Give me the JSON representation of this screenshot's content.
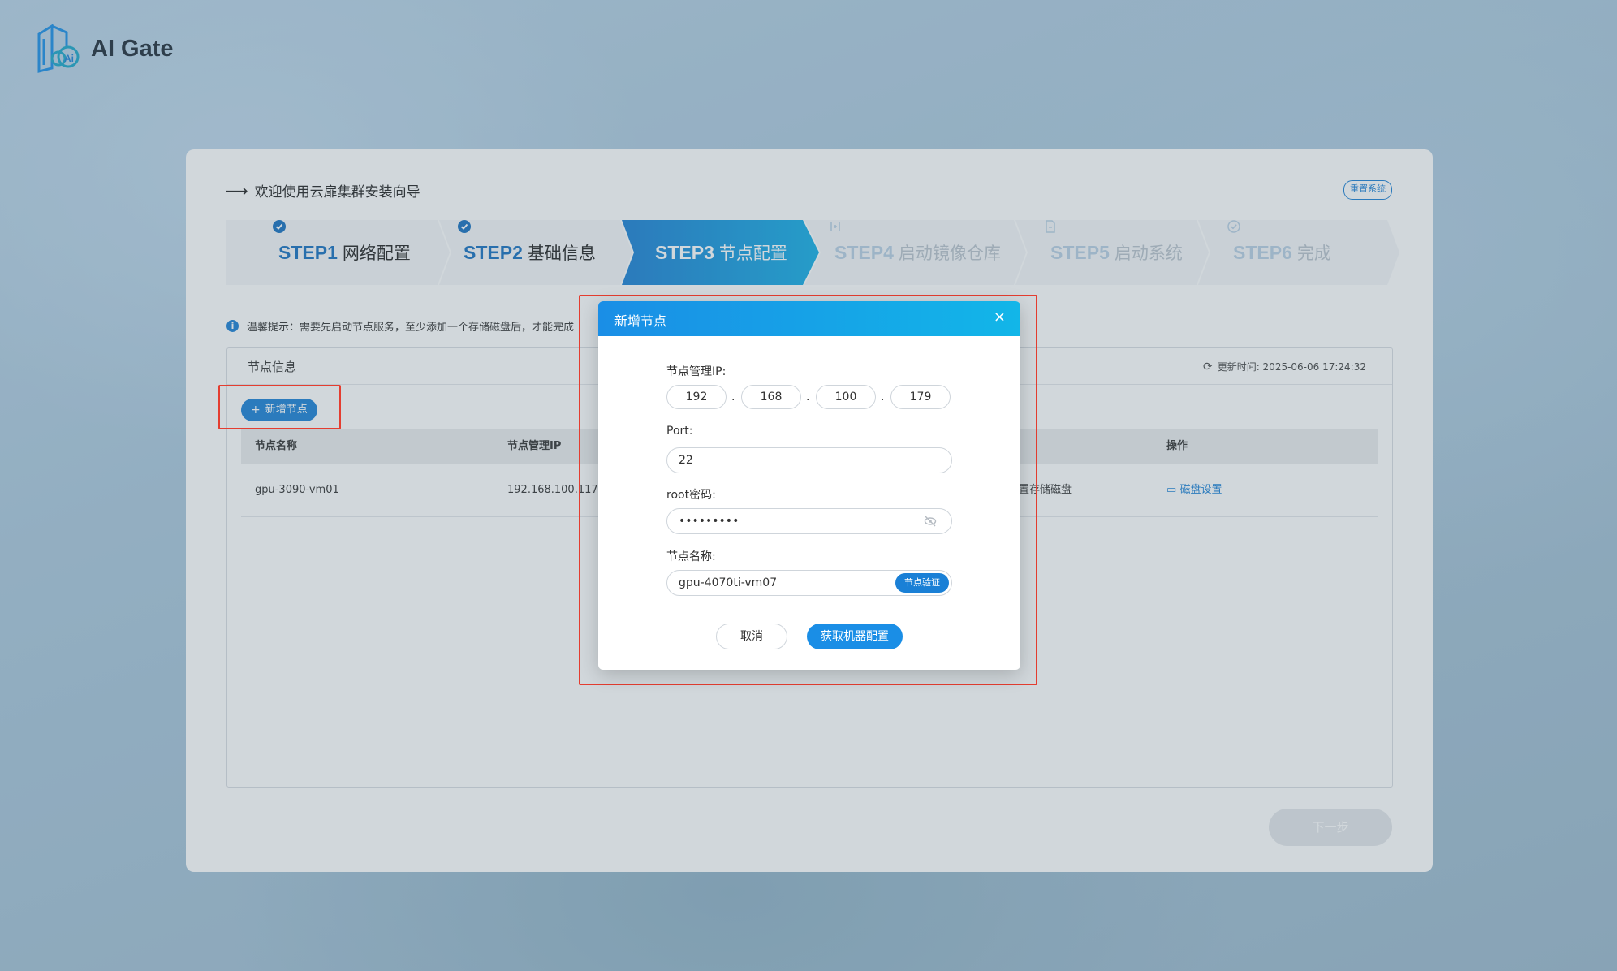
{
  "app": {
    "logo_text": "AI Gate"
  },
  "wizard": {
    "title": "欢迎使用云扉集群安装向导",
    "reset_label": "重置系统",
    "steps": [
      {
        "num": "STEP1",
        "name": "网络配置",
        "state": "done"
      },
      {
        "num": "STEP2",
        "name": "基础信息",
        "state": "done"
      },
      {
        "num": "STEP3",
        "name": "节点配置",
        "state": "active"
      },
      {
        "num": "STEP4",
        "name": "启动镜像仓库",
        "state": "todo"
      },
      {
        "num": "STEP5",
        "name": "启动系统",
        "state": "todo"
      },
      {
        "num": "STEP6",
        "name": "完成",
        "state": "todo"
      }
    ],
    "tip": "温馨提示：需要先启动节点服务，至少添加一个存储磁盘后，才能完成",
    "node_section": {
      "title": "节点信息",
      "update_time": "更新时间: 2025-06-06 17:24:32",
      "add_button": "新增节点"
    },
    "table": {
      "headers": [
        "节点名称",
        "节点管理IP",
        "操作"
      ],
      "rows": [
        {
          "name": "gpu-3090-vm01",
          "ip": "192.168.100.117",
          "status_fragment": "置存储磁盘",
          "action": "磁盘设置"
        }
      ]
    },
    "next_button": "下一步"
  },
  "modal": {
    "title": "新增节点",
    "close": "×",
    "ip_label": "节点管理IP:",
    "ip_octets": [
      "192",
      "168",
      "100",
      "179"
    ],
    "ip_separator": ".",
    "port_label": "Port:",
    "port_value": "22",
    "password_label": "root密码:",
    "password_value": "•••••••••",
    "node_name_label": "节点名称:",
    "node_name_value": "gpu-4070ti-vm07",
    "verify_button": "节点验证",
    "cancel_button": "取消",
    "submit_button": "获取机器配置"
  },
  "colors": {
    "primary": "#1a80d6",
    "active_step": "#1a8ee6",
    "highlight_frame": "#e43d30"
  }
}
